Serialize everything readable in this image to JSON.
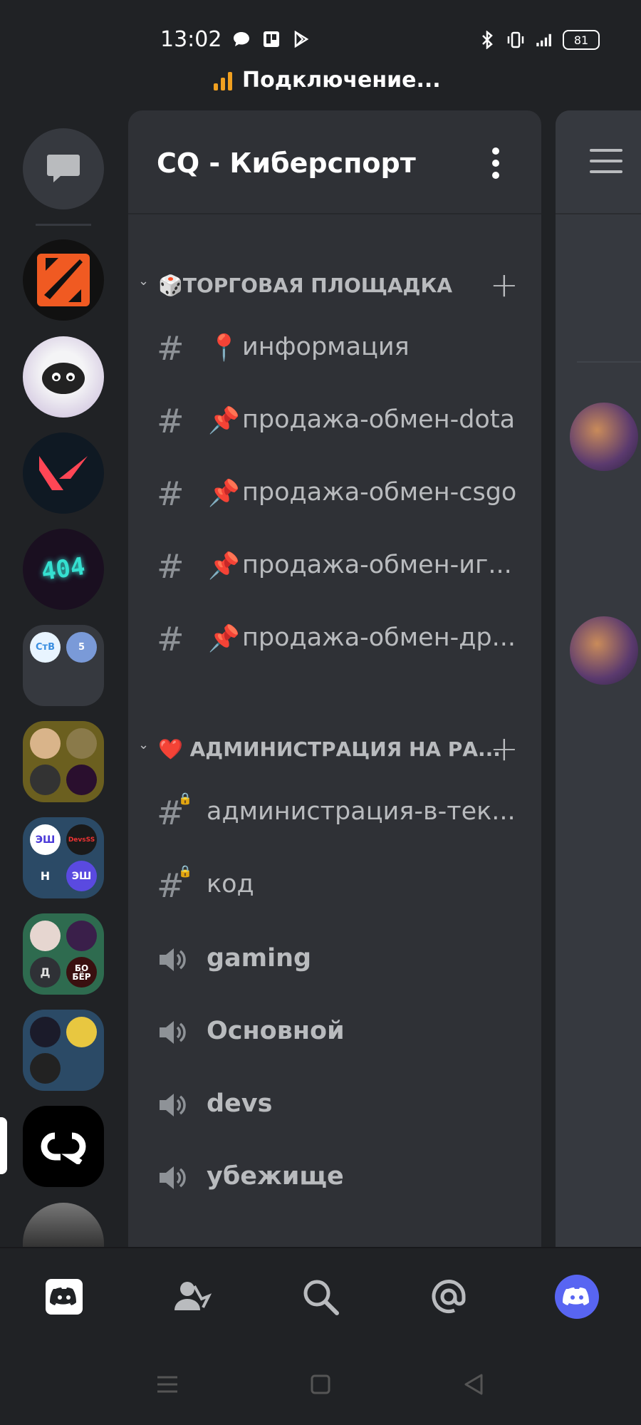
{
  "status_bar": {
    "time": "13:02",
    "battery": "81",
    "connecting_text": "Подключение..."
  },
  "server": {
    "name": "CQ - Киберспорт"
  },
  "categories": [
    {
      "emoji": "🎲",
      "label": "ТОРГОВАЯ ПЛОЩАДКА",
      "channels": [
        {
          "emoji": "📍",
          "name": "информация",
          "type": "text"
        },
        {
          "emoji": "📌",
          "name": "продажа-обмен-dota",
          "type": "text"
        },
        {
          "emoji": "📌",
          "name": "продажа-обмен-csgo",
          "type": "text"
        },
        {
          "emoji": "📌",
          "name": "продажа-обмен-иг...",
          "type": "text"
        },
        {
          "emoji": "📌",
          "name": "продажа-обмен-др...",
          "type": "text"
        }
      ]
    },
    {
      "emoji": "❤️",
      "label": "АДМИНИСТРАЦИЯ НА РА...",
      "channels": [
        {
          "name": "администрация-в-тек...",
          "type": "text-locked"
        },
        {
          "name": "код",
          "type": "text-locked"
        },
        {
          "name": "gaming",
          "type": "voice"
        },
        {
          "name": "Основной",
          "type": "voice"
        },
        {
          "name": "devs",
          "type": "voice"
        },
        {
          "name": "убежище",
          "type": "voice"
        }
      ]
    }
  ],
  "server_rail": {
    "folders": {
      "f1": [
        "СтВ",
        "5"
      ],
      "f3": [
        "ЭШ",
        "DevsSS",
        "Н",
        "ЭШ"
      ],
      "f4": [
        "",
        "",
        "Д",
        "БО БЁР"
      ]
    },
    "valorant_label": "V",
    "server_404": "404"
  },
  "icons": {
    "home": "discord-logo-icon",
    "friends": "friends-icon",
    "search": "search-icon",
    "mentions": "at-mention-icon",
    "profile": "profile-avatar-icon"
  },
  "colors": {
    "bg": "#202225",
    "panel": "#2f3136",
    "accent": "#5865f2",
    "signal": "#f0a020"
  }
}
